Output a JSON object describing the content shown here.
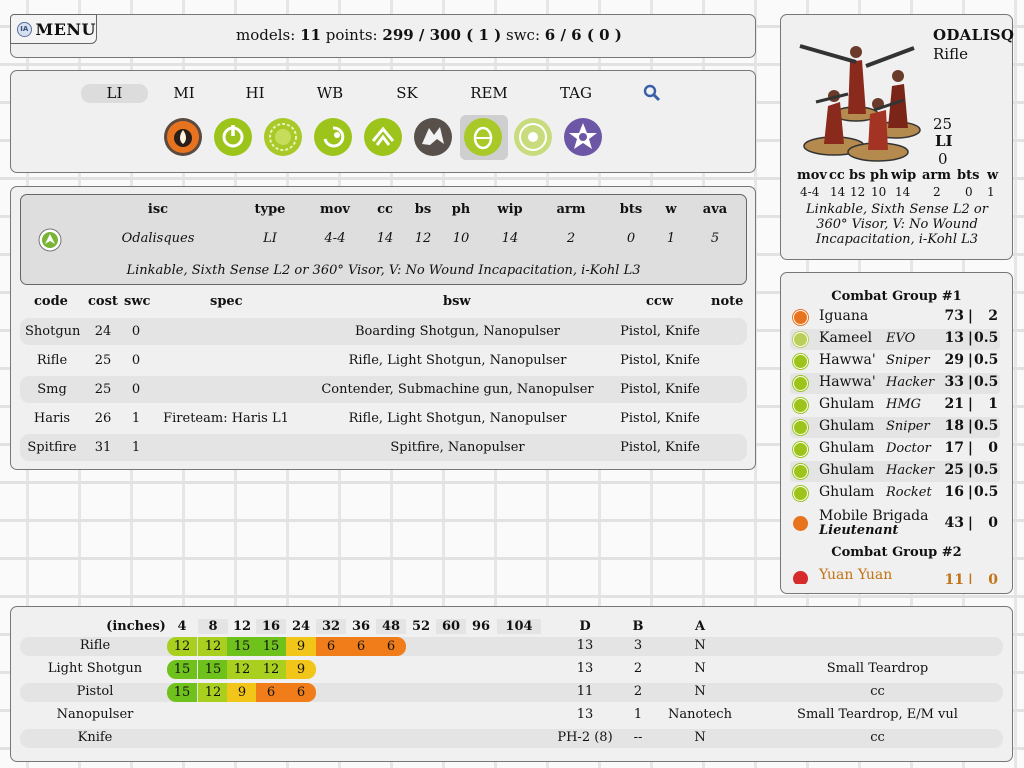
{
  "topbar": {
    "menu_label": "MENU",
    "logo_text": "IA",
    "models_label": "models:",
    "models_value": "11",
    "points_label": "points:",
    "points_value": "299 / 300 ( 1 )",
    "swc_label": "swc:",
    "swc_value": "6 / 6 ( 0 )"
  },
  "filters": {
    "types": [
      "LI",
      "MI",
      "HI",
      "WB",
      "SK",
      "REM",
      "TAG"
    ],
    "active_type": "LI",
    "factions": [
      {
        "icon": "orange-flame-icon",
        "color": "#e8731e"
      },
      {
        "icon": "power-circle-icon",
        "color": "#9cc41a"
      },
      {
        "icon": "sunburst-icon",
        "color": "#a8c928"
      },
      {
        "icon": "moon-circle-icon",
        "color": "#9cc41a"
      },
      {
        "icon": "knot-icon",
        "color": "#9cc41a"
      },
      {
        "icon": "wolf-icon",
        "color": "#58504a"
      },
      {
        "icon": "egg-shield-icon",
        "color": "#a8c928"
      },
      {
        "icon": "ringed-star-icon",
        "color": "#b9cf5a"
      },
      {
        "icon": "skull-star-icon",
        "color": "#6c56a6"
      }
    ]
  },
  "profile": {
    "headers": [
      "isc",
      "type",
      "mov",
      "cc",
      "bs",
      "ph",
      "wip",
      "arm",
      "bts",
      "w",
      "ava"
    ],
    "values": [
      "Odalisques",
      "LI",
      "4-4",
      "14",
      "12",
      "10",
      "14",
      "2",
      "0",
      "1",
      "5"
    ],
    "skills": "Linkable, Sixth Sense L2 or 360° Visor, V: No Wound Incapacitation, i-Kohl L3"
  },
  "options": {
    "headers": [
      "code",
      "cost",
      "swc",
      "spec",
      "bsw",
      "ccw",
      "note"
    ],
    "rows": [
      {
        "code": "Shotgun",
        "cost": "24",
        "swc": "0",
        "spec": "",
        "bsw": "Boarding Shotgun, Nanopulser",
        "ccw": "Pistol, Knife"
      },
      {
        "code": "Rifle",
        "cost": "25",
        "swc": "0",
        "spec": "",
        "bsw": "Rifle, Light Shotgun, Nanopulser",
        "ccw": "Pistol, Knife"
      },
      {
        "code": "Smg",
        "cost": "25",
        "swc": "0",
        "spec": "",
        "bsw": "Contender, Submachine gun, Nanopulser",
        "ccw": "Pistol, Knife"
      },
      {
        "code": "Haris",
        "cost": "26",
        "swc": "1",
        "spec": "Fireteam: Haris L1",
        "bsw": "Rifle, Light Shotgun, Nanopulser",
        "ccw": "Pistol, Knife"
      },
      {
        "code": "Spitfire",
        "cost": "31",
        "swc": "1",
        "spec": "",
        "bsw": "Spitfire, Nanopulser",
        "ccw": "Pistol, Knife"
      }
    ]
  },
  "card": {
    "name": "ODALISQ",
    "code": "Rifle",
    "cost": "25",
    "type": "LI",
    "swc": "0",
    "headers": [
      "mov",
      "cc",
      "bs",
      "ph",
      "wip",
      "arm",
      "bts",
      "w"
    ],
    "values": [
      "4-4",
      "14",
      "12",
      "10",
      "14",
      "2",
      "0",
      "1"
    ],
    "skills": "Linkable, Sixth Sense L2 or 360° Visor, V: No Wound Incapacitation, i-Kohl L3"
  },
  "army": {
    "group1_title": "Combat Group #1",
    "group2_title": "Combat Group #2",
    "units": [
      {
        "name": "Iguana",
        "profile": "",
        "points": "73",
        "swc": "2",
        "icon_color": "#e8731e"
      },
      {
        "name": "Kameel",
        "profile": "EVO",
        "points": "13",
        "swc": "0.5",
        "icon_color": "#b9cf5a"
      },
      {
        "name": "Hawwa'",
        "profile": "Sniper",
        "points": "29",
        "swc": "0.5",
        "icon_color": "#9cc41a"
      },
      {
        "name": "Hawwa'",
        "profile": "Hacker",
        "points": "33",
        "swc": "0.5",
        "icon_color": "#9cc41a"
      },
      {
        "name": "Ghulam",
        "profile": "HMG",
        "points": "21",
        "swc": "1",
        "icon_color": "#9cc41a"
      },
      {
        "name": "Ghulam",
        "profile": "Sniper",
        "points": "18",
        "swc": "0.5",
        "icon_color": "#9cc41a"
      },
      {
        "name": "Ghulam",
        "profile": "Doctor",
        "points": "17",
        "swc": "0",
        "icon_color": "#9cc41a"
      },
      {
        "name": "Ghulam",
        "profile": "Hacker",
        "points": "25",
        "swc": "0.5",
        "icon_color": "#9cc41a"
      },
      {
        "name": "Ghulam",
        "profile": "Rocket",
        "points": "16",
        "swc": "0.5",
        "icon_color": "#9cc41a"
      }
    ],
    "lieutenant": {
      "name": "Mobile Brigada",
      "profile": "Lieutenant",
      "points": "43",
      "swc": "0",
      "icon_color": "#e8731e"
    },
    "group2_first": {
      "name": "Yuan Yuan",
      "points": "11",
      "swc": "0",
      "icon_color": "#d62b2b"
    }
  },
  "weapons": {
    "range_label": "(inches)",
    "ranges": [
      "4",
      "8",
      "12",
      "16",
      "24",
      "32",
      "36",
      "48",
      "52",
      "60",
      "96",
      "104"
    ],
    "col_d": "D",
    "col_b": "B",
    "col_a": "A",
    "rows": [
      {
        "name": "Rifle",
        "mods": [
          "12",
          "12",
          "15",
          "15",
          "9",
          "6",
          "6",
          "6"
        ],
        "d": "13",
        "b": "3",
        "a": "N",
        "traits": ""
      },
      {
        "name": "Light Shotgun",
        "mods": [
          "15",
          "15",
          "12",
          "12",
          "9"
        ],
        "d": "13",
        "b": "2",
        "a": "N",
        "traits": "Small Teardrop"
      },
      {
        "name": "Pistol",
        "mods": [
          "15",
          "12",
          "9",
          "6",
          "6"
        ],
        "d": "11",
        "b": "2",
        "a": "N",
        "traits": "cc"
      },
      {
        "name": "Nanopulser",
        "mods": [],
        "d": "13",
        "b": "1",
        "a": "Nanotech",
        "traits": "Small Teardrop, E/M vul"
      },
      {
        "name": "Knife",
        "mods": [],
        "d": "PH-2 (8)",
        "b": "--",
        "a": "N",
        "traits": "cc"
      }
    ],
    "mod_colors": {
      "15": "#6fc21b",
      "12": "#a9cf1f",
      "9": "#f2c618",
      "6": "#f07d1a"
    }
  }
}
